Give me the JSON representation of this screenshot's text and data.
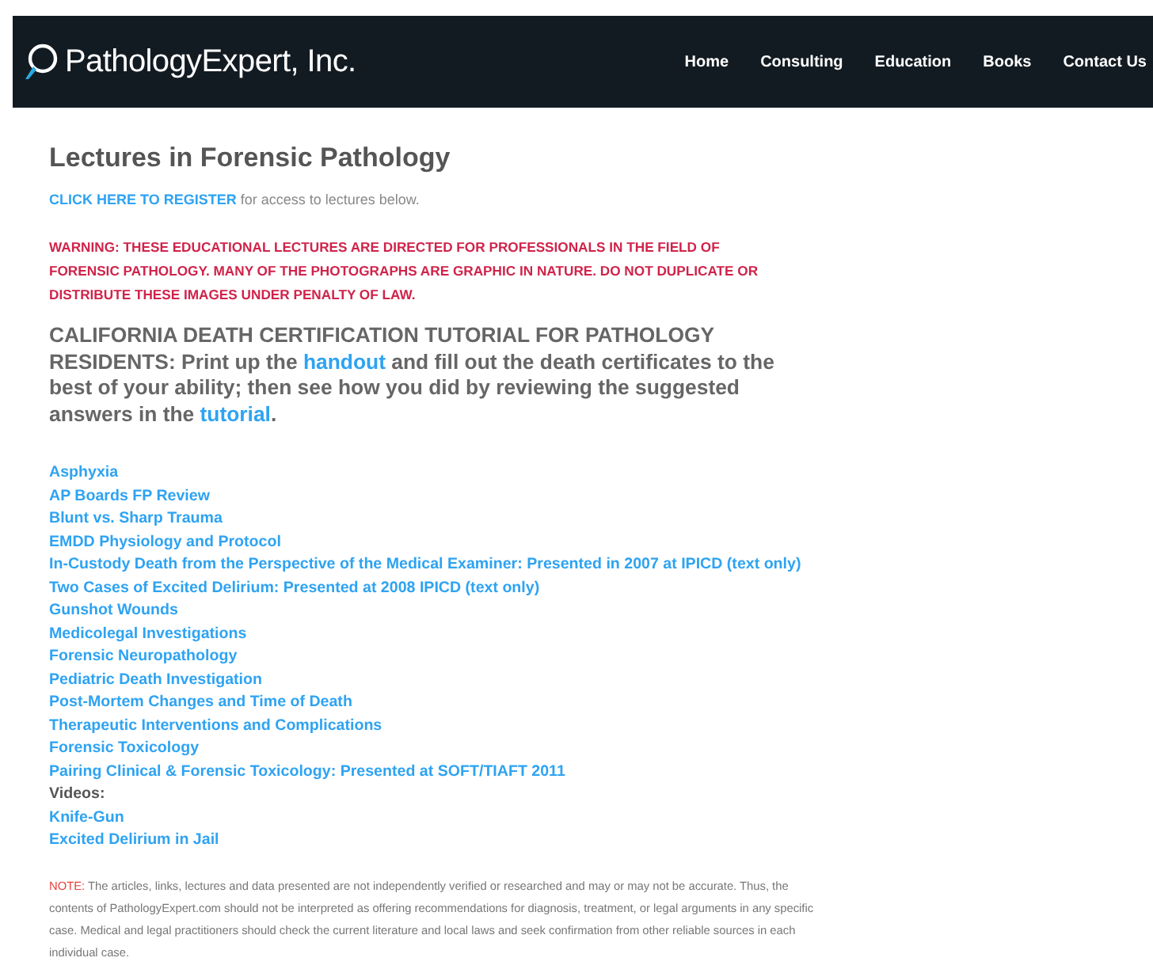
{
  "header": {
    "logo": "PathologyExpert, Inc.",
    "nav": [
      "Home",
      "Consulting",
      "Education",
      "Books",
      "Contact Us"
    ]
  },
  "title": "Lectures in Forensic Pathology",
  "register": {
    "link": "CLICK HERE TO REGISTER",
    "text": "for access to lectures below."
  },
  "warning": "WARNING: THESE EDUCATIONAL LECTURES ARE DIRECTED FOR PROFESSIONALS IN THE FIELD OF FORENSIC PATHOLOGY. MANY OF THE PHOTOGRAPHS ARE GRAPHIC IN NATURE. DO NOT DUPLICATE OR DISTRIBUTE THESE IMAGES UNDER PENALTY OF LAW.",
  "tutorial": [
    {
      "kind": "text",
      "text": "CALIFORNIA DEATH CERTIFICATION TUTORIAL FOR PATHOLOGY RESIDENTS: Print up the "
    },
    {
      "kind": "link",
      "text": "handout"
    },
    {
      "kind": "text",
      "text": " and fill out the death certificates to the best of your ability; then see how you did by reviewing the suggested answers in the "
    },
    {
      "kind": "link",
      "text": "tutorial"
    },
    {
      "kind": "text",
      "text": "."
    }
  ],
  "lectures": [
    {
      "kind": "link",
      "text": "Asphyxia"
    },
    {
      "kind": "link",
      "text": "AP Boards FP Review"
    },
    {
      "kind": "link",
      "text": "Blunt vs. Sharp Trauma"
    },
    {
      "kind": "link",
      "text": "EMDD Physiology and Protocol"
    },
    {
      "kind": "link",
      "text": "In-Custody Death from the Perspective of the Medical Examiner: Presented in 2007 at IPICD (text only)"
    },
    {
      "kind": "link",
      "text": "Two Cases of Excited Delirium: Presented at 2008 IPICD (text only)"
    },
    {
      "kind": "link",
      "text": "Gunshot Wounds"
    },
    {
      "kind": "link",
      "text": "Medicolegal Investigations"
    },
    {
      "kind": "link",
      "text": "Forensic Neuropathology"
    },
    {
      "kind": "link",
      "text": "Pediatric Death Investigation"
    },
    {
      "kind": "link",
      "text": "Post-Mortem Changes and Time of Death"
    },
    {
      "kind": "link",
      "text": "Therapeutic Interventions and Complications"
    },
    {
      "kind": "link",
      "text": "Forensic Toxicology"
    },
    {
      "kind": "link",
      "text": "Pairing Clinical & Forensic Toxicology: Presented at SOFT/TIAFT 2011"
    },
    {
      "kind": "label",
      "text": "Videos:"
    },
    {
      "kind": "link",
      "text": "Knife-Gun"
    },
    {
      "kind": "link",
      "text": "Excited Delirium in Jail"
    }
  ],
  "note": {
    "label": "NOTE:",
    "text": "The articles, links, lectures and data presented are not independently verified or researched and may or may not be accurate. Thus, the contents of PathologyExpert.com should not be interpreted as offering recommendations for diagnosis, treatment, or legal arguments in any specific case. Medical and legal practitioners should check the current literature and local laws and seek confirmation from other reliable sources in each individual case."
  }
}
